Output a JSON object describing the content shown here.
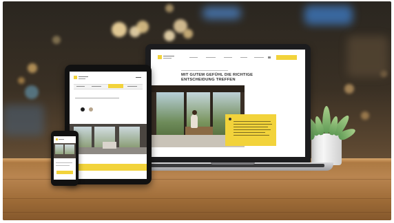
{
  "laptop_site": {
    "headline_line1": "MIT GUTEM GEFÜHL DIE RICHTIGE",
    "headline_line2": "ENTSCHEIDUNG TREFFEN"
  },
  "colors": {
    "accent": "#f2d33b",
    "device_frame": "#1c1c1e",
    "table_wood": "#a8763f"
  }
}
